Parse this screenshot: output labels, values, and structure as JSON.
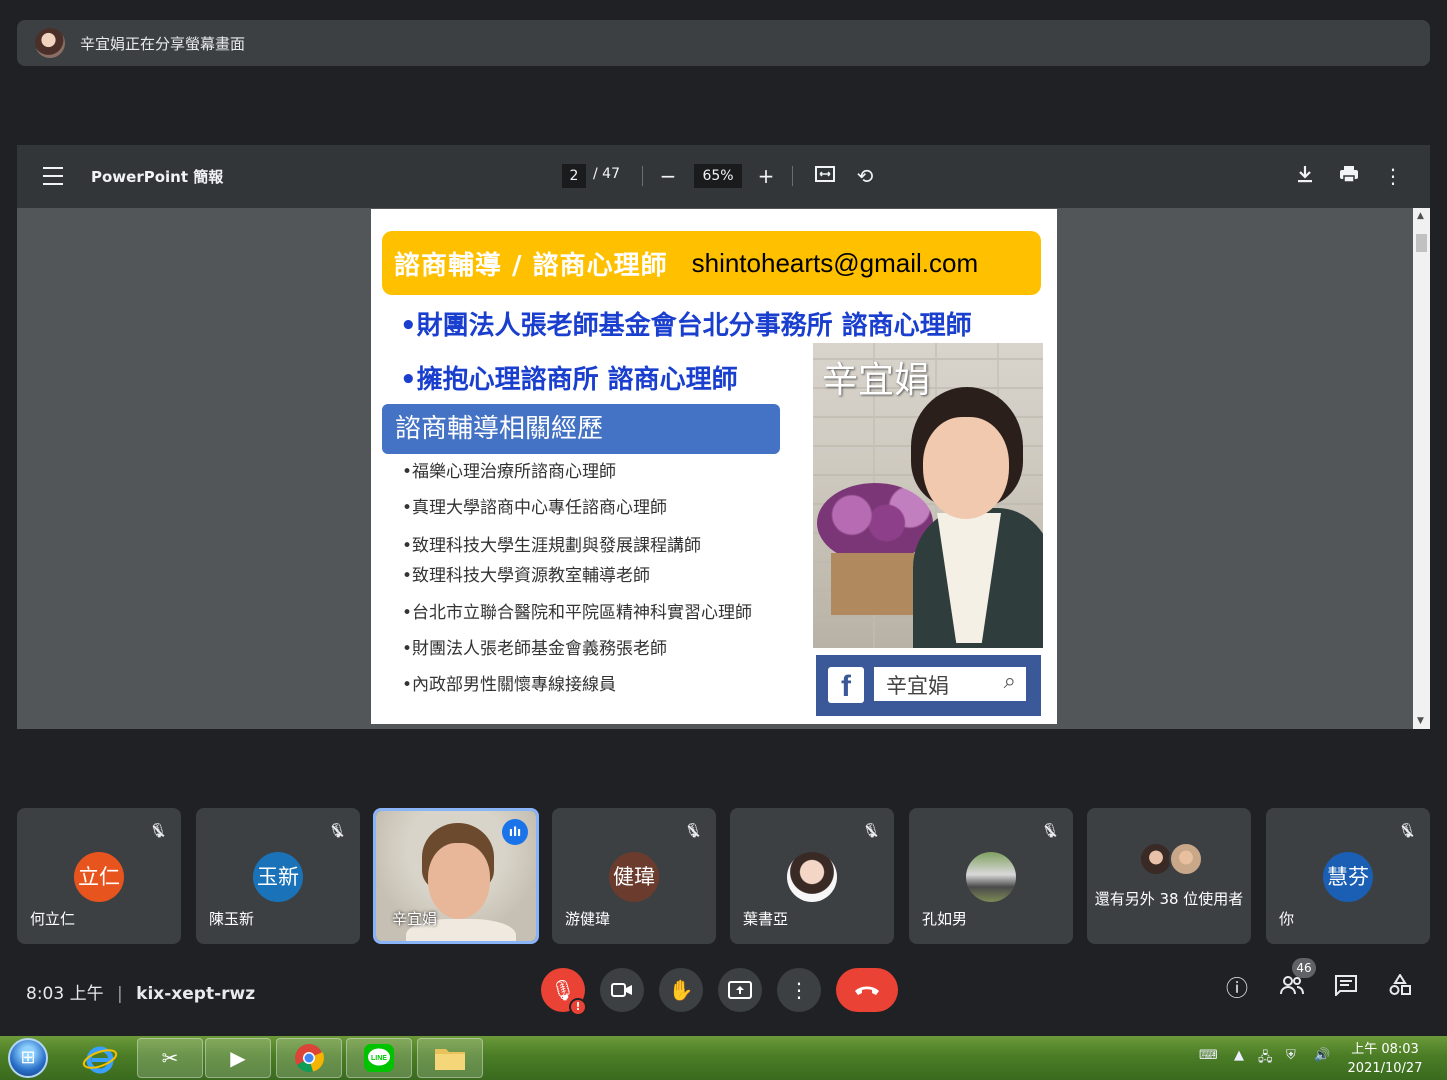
{
  "banner": {
    "text": "辛宜娟正在分享螢幕畫面"
  },
  "viewer": {
    "title": "PowerPoint 簡報",
    "page_current": "2",
    "page_total": "/ 47",
    "zoom": "65%",
    "icons": [
      "menu-icon",
      "zoom-out-icon",
      "zoom-in-icon",
      "fit-page-icon",
      "rotate-icon",
      "download-icon",
      "print-icon",
      "more-icon"
    ]
  },
  "slide": {
    "header_title": "諮商輔導 / 諮商心理師",
    "header_email": "shintohearts@gmail.com",
    "bullet1": "•財團法人張老師基金會台北分事務所 諮商心理師",
    "bullet2": "•擁抱心理諮商所 諮商心理師",
    "section_title": "諮商輔導相關經歷",
    "experience": [
      "•福樂心理治療所諮商心理師",
      "•真理大學諮商中心專任諮商心理師",
      "•致理科技大學生涯規劃與發展課程講師",
      "•致理科技大學資源教室輔導老師",
      "•台北市立聯合醫院和平院區精神科實習心理師",
      "•財團法人張老師基金會義務張老師",
      "•內政部男性關懷專線接線員"
    ],
    "photo_name": "辛宜娟",
    "fb_logo": "f",
    "fb_search_text": "辛宜娟"
  },
  "participants": [
    {
      "name": "何立仁",
      "avatar": "立仁",
      "color": "#e8541e"
    },
    {
      "name": "陳玉新",
      "avatar": "玉新",
      "color": "#1a73b8"
    },
    {
      "name": "辛宜娟"
    },
    {
      "name": "游健瑋",
      "avatar": "健瑋",
      "color": "#6b3c2e"
    },
    {
      "name": "葉書亞"
    },
    {
      "name": "孔如男"
    },
    {
      "label": "還有另外 38 位使用者"
    },
    {
      "name": "你",
      "avatar": "慧芬",
      "color": "#1a5fb4"
    }
  ],
  "meeting": {
    "time": "8:03 上午",
    "separator": "|",
    "code": "kix-xept-rwz",
    "participant_count": "46"
  },
  "taskbar": {
    "clock_time": "上午 08:03",
    "clock_date": "2021/10/27"
  }
}
